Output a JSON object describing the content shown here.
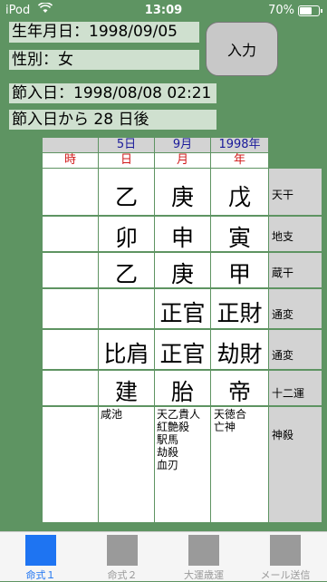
{
  "status": {
    "carrier": "iPod",
    "time": "13:09",
    "battery": "70%",
    "battery_level": 0.7
  },
  "form": {
    "birthdate": "生年月日：1998/09/05",
    "gender": "性別：女",
    "setsunyu_date": "節入日：1998/08/08 02:21",
    "days_after": "節入日から 28 日後",
    "input_button": "入力"
  },
  "header": {
    "day_num": "5日",
    "month_num": "9月",
    "year_num": "1998年",
    "col_hour": "時",
    "col_day": "日",
    "col_month": "月",
    "col_year": "年"
  },
  "rows": {
    "tenkan": {
      "hour": "",
      "day": "乙",
      "month": "庚",
      "year": "戊",
      "label": "天干"
    },
    "chishi": {
      "hour": "",
      "day": "卯",
      "month": "申",
      "year": "寅",
      "label": "地支"
    },
    "zoukan": {
      "hour": "",
      "day": "乙",
      "month": "庚",
      "year": "甲",
      "label": "蔵干"
    },
    "tsuhen1": {
      "hour": "",
      "day": "",
      "month": "正官",
      "year": "正財",
      "label": "通変"
    },
    "tsuhen2": {
      "hour": "",
      "day": "比肩",
      "month": "正官",
      "year": "劫財",
      "label": "通変"
    },
    "juuni": {
      "hour": "",
      "day": "建",
      "month": "胎",
      "year": "帝",
      "label": "十二運"
    },
    "shinsatsu": {
      "hour": "",
      "day": "咸池",
      "month": "天乙貴人\n紅艶殺\n駅馬\n劫殺\n血刃",
      "year": "天徳合\n亡神",
      "label": "神殺"
    }
  },
  "tabs": [
    {
      "label": "命式１",
      "active": true
    },
    {
      "label": "命式２",
      "active": false
    },
    {
      "label": "大運歳運",
      "active": false
    },
    {
      "label": "メール送信",
      "active": false
    }
  ]
}
